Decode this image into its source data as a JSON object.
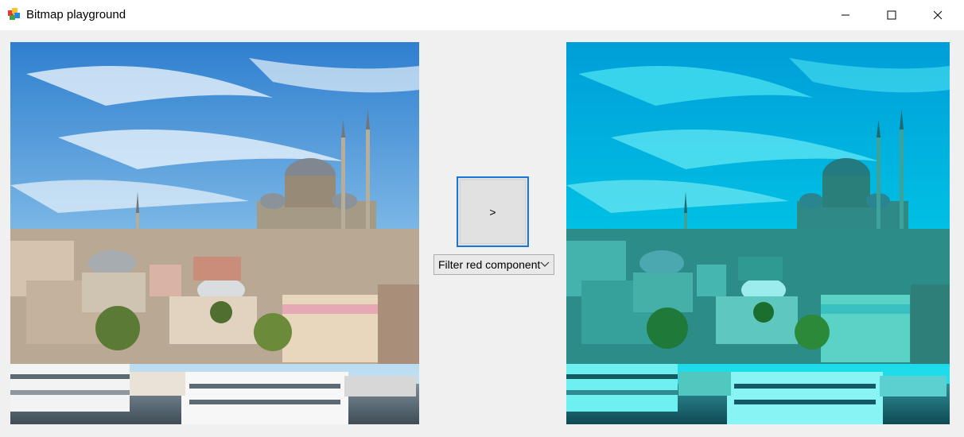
{
  "window": {
    "title": "Bitmap playground",
    "icon": "bitmap-app-icon",
    "controls": [
      "minimize-icon",
      "maximize-icon",
      "close-icon"
    ]
  },
  "main": {
    "apply_button_label": ">",
    "filter_dropdown": {
      "selected": "Filter red component",
      "icon": "chevron-down-icon"
    },
    "source_image": "original cityscape photo",
    "result_image": "filtered cityscape photo",
    "colors": {
      "accent": "#1976d2",
      "sky_original": "#3f8fd6",
      "sky_filtered": "#00c8e0"
    }
  }
}
